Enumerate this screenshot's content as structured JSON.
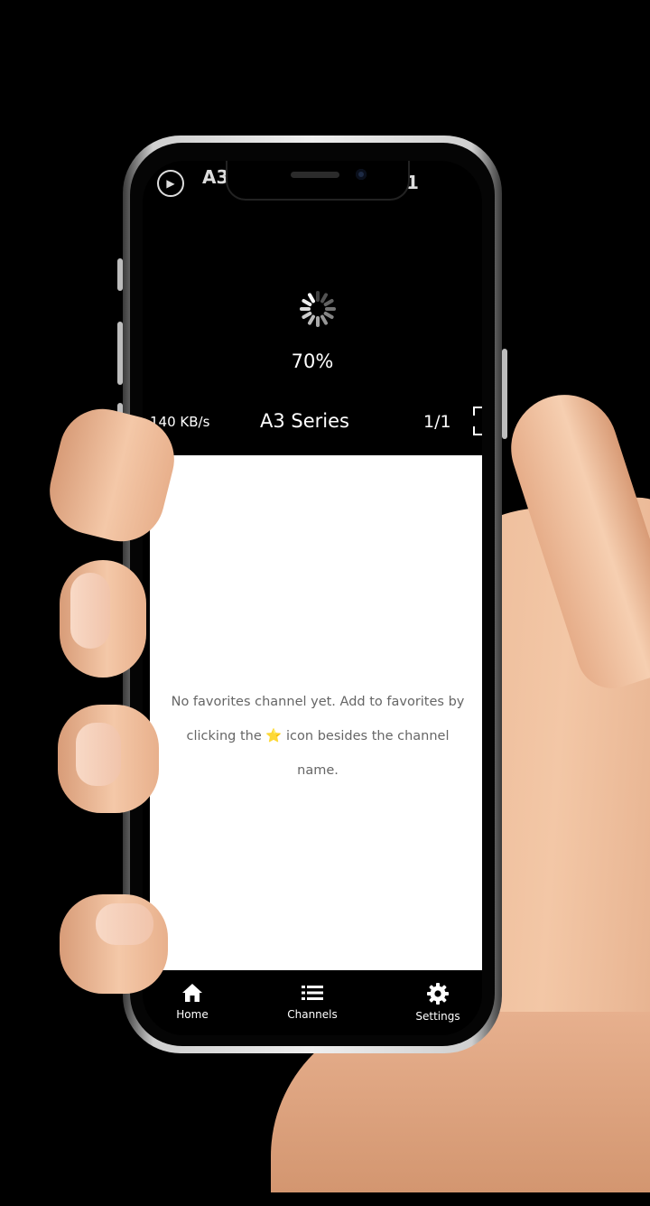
{
  "header": {
    "title_peek": "A3",
    "count_peek": "1"
  },
  "player": {
    "loading_percent": "70%",
    "speed": "140 KB/s",
    "channel_name": "A3 Series",
    "page": "1/1"
  },
  "favorites": {
    "empty_part1": "No favorites channel yet. Add to favorites by clicking the ",
    "star_glyph": "⭐",
    "empty_part2": " icon besides the channel name."
  },
  "tabs": [
    {
      "label": "Home",
      "icon": "home-icon"
    },
    {
      "label": "Channels",
      "icon": "list-icon"
    },
    {
      "label": "Settings",
      "icon": "gear-icon"
    }
  ],
  "colors": {
    "background": "#000000",
    "content_bg": "#ffffff",
    "star": "#f4c400"
  }
}
